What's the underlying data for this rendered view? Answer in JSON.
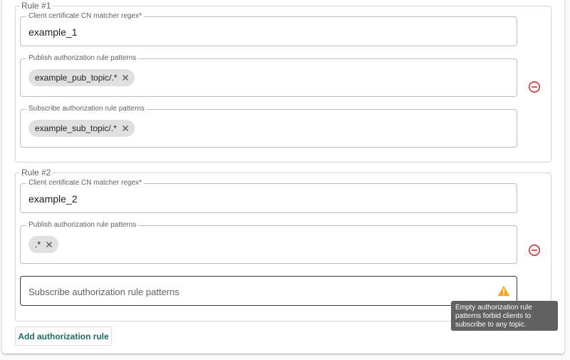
{
  "rules": [
    {
      "legend": "Rule #1",
      "cn_label": "Client certificate CN matcher regex*",
      "cn_value": "example_1",
      "publish_label": "Publish authorization rule patterns",
      "publish_chips": [
        "example_pub_topic/.*"
      ],
      "subscribe_label": "Subscribe authorization rule patterns",
      "subscribe_chips": [
        "example_sub_topic/.*"
      ]
    },
    {
      "legend": "Rule #2",
      "cn_label": "Client certificate CN matcher regex*",
      "cn_value": "example_2",
      "publish_label": "Publish authorization rule patterns",
      "publish_chips": [
        ".*"
      ],
      "subscribe_placeholder": "Subscribe authorization rule patterns"
    }
  ],
  "tooltip": "Empty authorization rule patterns forbid clients to subscribe to any topic.",
  "add_button": "Add authorization rule",
  "colors": {
    "remove": "#d32f2f",
    "warning": "#f5a623",
    "accent": "#1f6b63",
    "tooltip_bg": "#616161"
  },
  "icons": {
    "remove": "remove-circle-outline-icon",
    "chip_close": "close-icon",
    "warning": "warning-icon"
  }
}
